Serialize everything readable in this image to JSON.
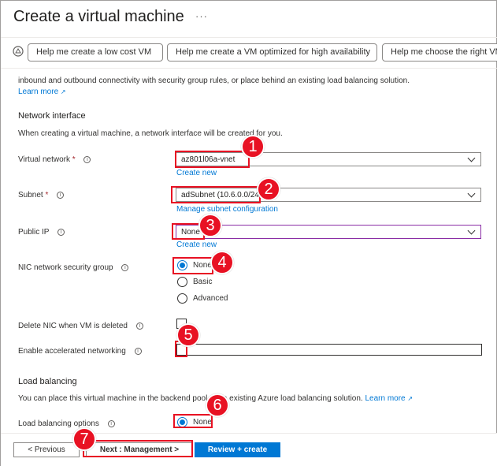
{
  "header": {
    "title": "Create a virtual machine",
    "more": "···"
  },
  "copilot": {
    "chips": [
      "Help me create a low cost VM",
      "Help me create a VM optimized for high availability",
      "Help me choose the right VM"
    ]
  },
  "intro": {
    "text": "inbound and outbound connectivity with security group rules, or place behind an existing load balancing solution.",
    "learn_more": "Learn more"
  },
  "network_interface": {
    "heading": "Network interface",
    "description": "When creating a virtual machine, a network interface will be created for you.",
    "virtual_network": {
      "label": "Virtual network",
      "value": "az801l06a-vnet",
      "create_new": "Create new"
    },
    "subnet": {
      "label": "Subnet",
      "value": "adSubnet (10.6.0.0/24)",
      "manage": "Manage subnet configuration"
    },
    "public_ip": {
      "label": "Public IP",
      "value": "None",
      "create_new": "Create new"
    },
    "nic_nsg": {
      "label": "NIC network security group",
      "options": [
        "None",
        "Basic",
        "Advanced"
      ],
      "selected": "None"
    },
    "delete_nic": {
      "label": "Delete NIC when VM is deleted"
    },
    "accelerated": {
      "label": "Enable accelerated networking"
    }
  },
  "load_balancing": {
    "heading": "Load balancing",
    "description": "You can place this virtual machine in the backend pool of an existing Azure load balancing solution.",
    "learn_more": "Learn more",
    "options_label": "Load balancing options",
    "options": [
      "None"
    ],
    "selected": "None"
  },
  "footer": {
    "previous": "< Previous",
    "next": "Next : Management >",
    "review": "Review + create"
  },
  "annotations": [
    "1",
    "2",
    "3",
    "4",
    "5",
    "6",
    "7"
  ],
  "colors": {
    "accent": "#0078d4",
    "annotation": "#e81123",
    "required": "#a4262c"
  }
}
